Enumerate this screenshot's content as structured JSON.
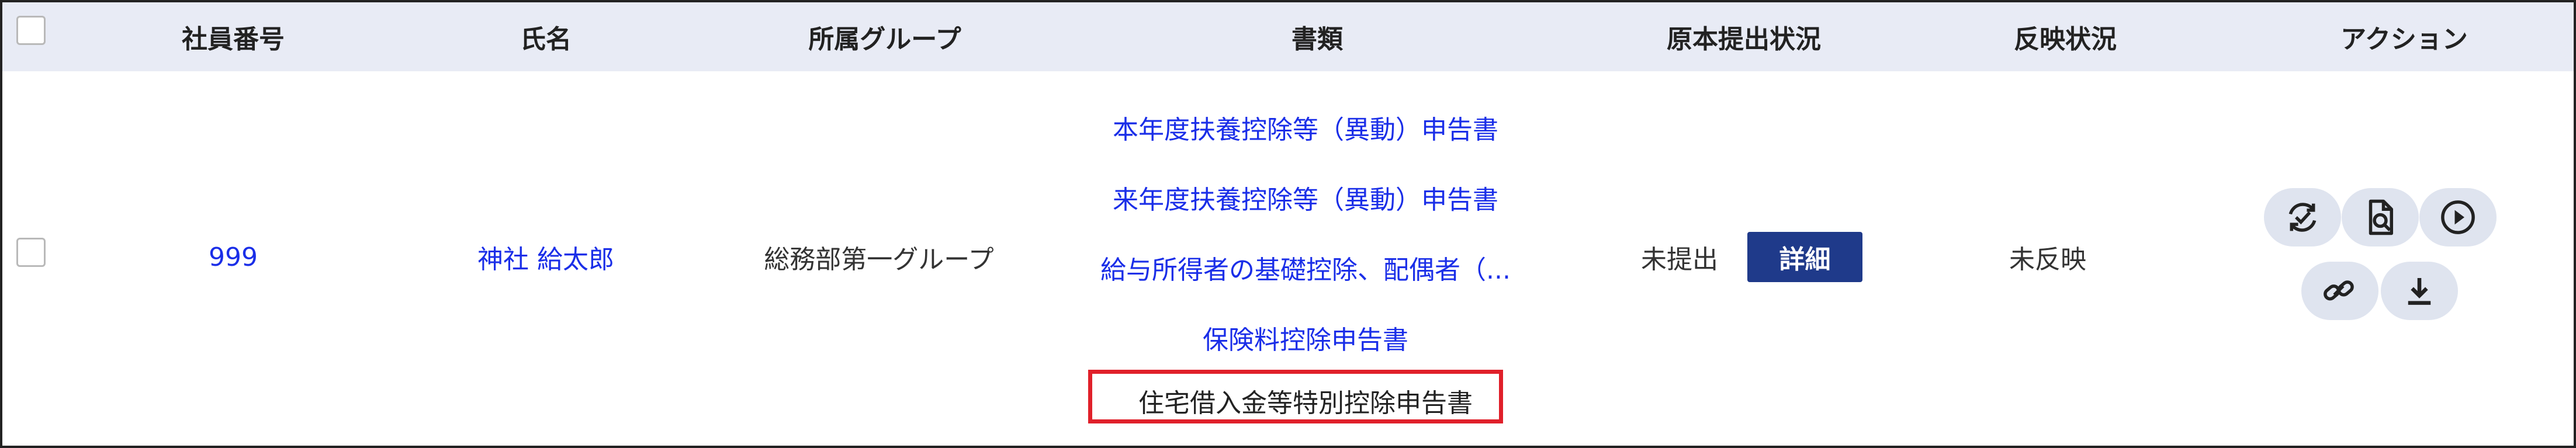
{
  "table": {
    "headers": {
      "employee_no": "社員番号",
      "name": "氏名",
      "group": "所属グループ",
      "documents": "書類",
      "original_status": "原本提出状況",
      "reflect_status": "反映状況",
      "actions": "アクション"
    },
    "row": {
      "employee_no": "999",
      "name": "神社 給太郎",
      "group": "総務部第一グループ",
      "documents": [
        "本年度扶養控除等（異動）申告書",
        "来年度扶養控除等（異動）申告書",
        "給与所得者の基礎控除、配偶者（...",
        "保険料控除申告書",
        "住宅借入金等特別控除申告書"
      ],
      "original_status": "未提出",
      "detail_button": "詳細",
      "reflect_status": "未反映",
      "action_icons": [
        "sync-check-icon",
        "document-search-icon",
        "play-icon",
        "link-icon",
        "download-icon"
      ]
    }
  },
  "colors": {
    "header_bg": "#e8ebf5",
    "link": "#1a2ee8",
    "button_bg": "#1f3a8a",
    "highlight": "#e0202a",
    "action_bg": "#dfe4ef"
  }
}
